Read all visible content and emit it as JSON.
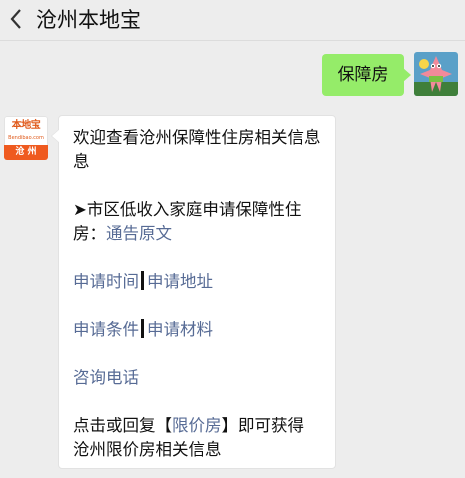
{
  "header": {
    "back_icon": "chevron-left-icon",
    "title": "沧州本地宝"
  },
  "outgoing": {
    "text": "保障房"
  },
  "incoming": {
    "avatar": {
      "brand": "本地宝",
      "url": "Bendibao.com",
      "city": "沧 州"
    },
    "welcome_line1": "欢迎查看沧州保障性住房相关信息",
    "welcome_line2": "息",
    "notice_prefix": "➤市区低收入家庭申请保障性住",
    "notice_line2_prefix": "房：",
    "notice_link": "通告原文",
    "links_row1": [
      "申请时间",
      "申请地址"
    ],
    "links_row2": [
      "申请条件",
      "申请材料"
    ],
    "phone_link": "咨询电话",
    "footer_line1_prefix": "点击或回复【",
    "footer_keyword": "限价房",
    "footer_line1_suffix": "】即可获得",
    "footer_line2": "沧州限价房相关信息"
  },
  "colors": {
    "background": "#ededed",
    "outgoing_bubble": "#95ec69",
    "link": "#576b95",
    "brand_orange": "#ef5a1f"
  }
}
